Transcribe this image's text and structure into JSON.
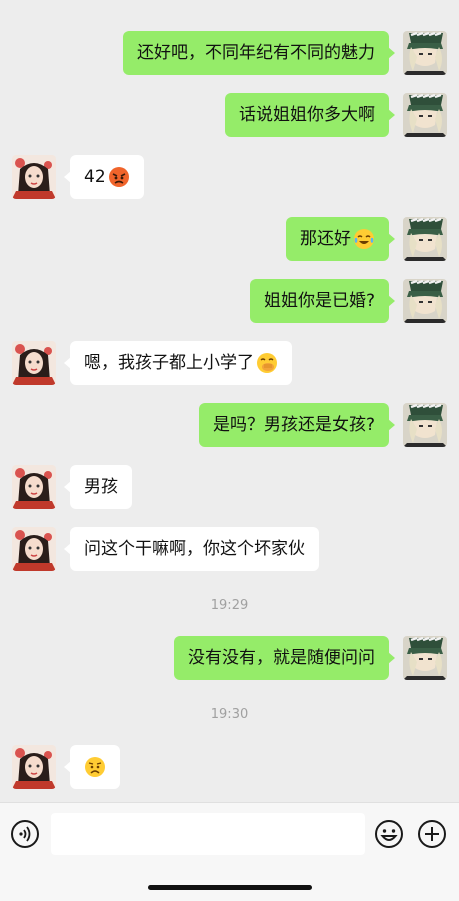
{
  "messages": [
    {
      "side": "right",
      "text": "还好吧，不同年纪有不同的魅力"
    },
    {
      "side": "right",
      "text": "话说姐姐你多大啊"
    },
    {
      "side": "left",
      "text": "42",
      "emoji": "angry-face-emoji"
    },
    {
      "side": "right",
      "text": "那还好",
      "emoji": "tears-of-joy-emoji"
    },
    {
      "side": "right",
      "text": "姐姐你是已婚?"
    },
    {
      "side": "left",
      "text": "嗯，我孩子都上小学了",
      "emoji": "hand-over-mouth-emoji"
    },
    {
      "side": "right",
      "text": "是吗？男孩还是女孩?"
    },
    {
      "side": "left",
      "text": "男孩"
    },
    {
      "side": "left",
      "text": "问这个干嘛啊，你这个坏家伙"
    },
    {
      "time": "19:29"
    },
    {
      "side": "right",
      "text": "没有没有，就是随便问问"
    },
    {
      "time": "19:30"
    },
    {
      "side": "left",
      "text": "",
      "emoji": "frowning-face-emoji"
    }
  ],
  "input_bar": {
    "placeholder": "",
    "icons": [
      "voice-icon",
      "emoji-icon",
      "plus-icon"
    ]
  },
  "colors": {
    "background": "#ededed",
    "sent_bubble": "#95ec69",
    "received_bubble": "#ffffff",
    "timestamp": "#a0a0a0"
  }
}
